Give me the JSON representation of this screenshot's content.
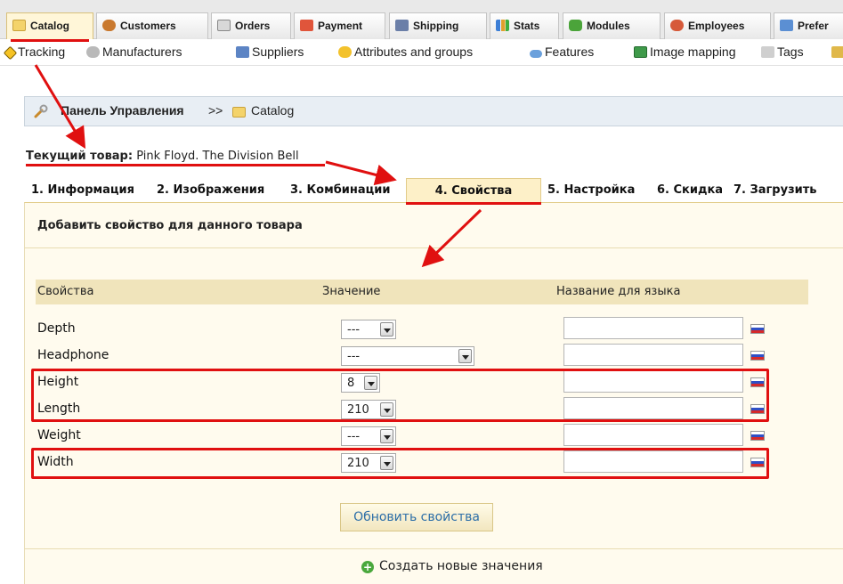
{
  "main_tabs": [
    {
      "label": "Catalog",
      "icon": "folder-icon"
    },
    {
      "label": "Customers",
      "icon": "customers-icon"
    },
    {
      "label": "Orders",
      "icon": "orders-icon"
    },
    {
      "label": "Payment",
      "icon": "payment-icon"
    },
    {
      "label": "Shipping",
      "icon": "truck-icon"
    },
    {
      "label": "Stats",
      "icon": "stats-icon"
    },
    {
      "label": "Modules",
      "icon": "modules-icon"
    },
    {
      "label": "Employees",
      "icon": "employees-icon"
    },
    {
      "label": "Prefer",
      "icon": "preferences-icon"
    }
  ],
  "sub_tabs": [
    {
      "label": "Tracking",
      "icon": "tracking-icon"
    },
    {
      "label": "Manufacturers",
      "icon": "manufacturers-icon"
    },
    {
      "label": "Suppliers",
      "icon": "suppliers-icon"
    },
    {
      "label": "Attributes and groups",
      "icon": "attributes-icon"
    },
    {
      "label": "Features",
      "icon": "features-icon"
    },
    {
      "label": "Image mapping",
      "icon": "image-mapping-icon"
    },
    {
      "label": "Tags",
      "icon": "tags-icon"
    }
  ],
  "breadcrumb": {
    "title": "Панель Управления",
    "separator": ">>",
    "current": "Catalog"
  },
  "current_product": {
    "label": "Текущий товар:",
    "name": "Pink Floyd. The Division Bell"
  },
  "product_tabs": [
    "1. Информация",
    "2. Изображения",
    "3. Комбинации",
    "4. Свойства",
    "5. Настройка",
    "6. Скидка",
    "7. Загрузить"
  ],
  "panel": {
    "title": "Добавить свойство для данного товара",
    "columns": [
      "Свойства",
      "Значение",
      "Название для языка"
    ],
    "rows": [
      {
        "feature": "Depth",
        "value": "---"
      },
      {
        "feature": "Headphone",
        "value": "---"
      },
      {
        "feature": "Height",
        "value": "8"
      },
      {
        "feature": "Length",
        "value": "210"
      },
      {
        "feature": "Weight",
        "value": "---"
      },
      {
        "feature": "Width",
        "value": "210"
      }
    ],
    "update_button": "Обновить свойства",
    "create_link": "Создать новые значения"
  },
  "colors": {
    "annotation": "#e01010",
    "active_tab": "#fdf0c8",
    "panel": "#fffbee"
  }
}
